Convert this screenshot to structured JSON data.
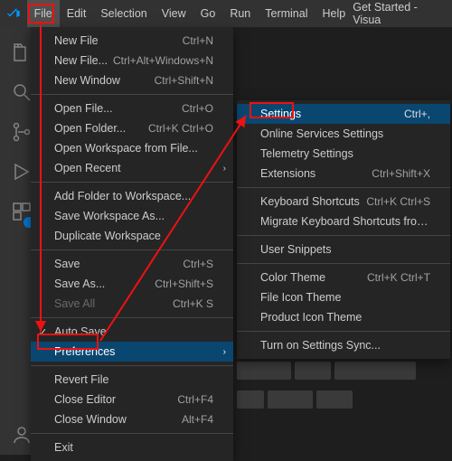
{
  "titlebar": {
    "title": "Get Started - Visua",
    "menus": [
      "File",
      "Edit",
      "Selection",
      "View",
      "Go",
      "Run",
      "Terminal",
      "Help"
    ]
  },
  "activitybar": {
    "icons": [
      "files-icon",
      "search-icon",
      "source-control-icon",
      "debug-icon",
      "extensions-icon",
      "account-icon"
    ]
  },
  "file_menu": {
    "groups": [
      [
        {
          "label": "New File",
          "accel": "Ctrl+N"
        },
        {
          "label": "New File...",
          "accel": "Ctrl+Alt+Windows+N"
        },
        {
          "label": "New Window",
          "accel": "Ctrl+Shift+N"
        }
      ],
      [
        {
          "label": "Open File...",
          "accel": "Ctrl+O"
        },
        {
          "label": "Open Folder...",
          "accel": "Ctrl+K Ctrl+O"
        },
        {
          "label": "Open Workspace from File..."
        },
        {
          "label": "Open Recent",
          "submenu": true
        }
      ],
      [
        {
          "label": "Add Folder to Workspace..."
        },
        {
          "label": "Save Workspace As..."
        },
        {
          "label": "Duplicate Workspace"
        }
      ],
      [
        {
          "label": "Save",
          "accel": "Ctrl+S"
        },
        {
          "label": "Save As...",
          "accel": "Ctrl+Shift+S"
        },
        {
          "label": "Save All",
          "accel": "Ctrl+K S",
          "disabled": true
        }
      ],
      [
        {
          "label": "Auto Save",
          "checked": true
        },
        {
          "label": "Preferences",
          "submenu": true,
          "highlight": true
        }
      ],
      [
        {
          "label": "Revert File"
        },
        {
          "label": "Close Editor",
          "accel": "Ctrl+F4"
        },
        {
          "label": "Close Window",
          "accel": "Alt+F4"
        }
      ],
      [
        {
          "label": "Exit"
        }
      ]
    ]
  },
  "preferences_submenu": {
    "groups": [
      [
        {
          "label": "Settings",
          "accel": "Ctrl+,",
          "highlight": true
        },
        {
          "label": "Online Services Settings"
        },
        {
          "label": "Telemetry Settings"
        },
        {
          "label": "Extensions",
          "accel": "Ctrl+Shift+X"
        }
      ],
      [
        {
          "label": "Keyboard Shortcuts",
          "accel": "Ctrl+K Ctrl+S"
        },
        {
          "label": "Migrate Keyboard Shortcuts from..."
        }
      ],
      [
        {
          "label": "User Snippets"
        }
      ],
      [
        {
          "label": "Color Theme",
          "accel": "Ctrl+K Ctrl+T"
        },
        {
          "label": "File Icon Theme"
        },
        {
          "label": "Product Icon Theme"
        }
      ],
      [
        {
          "label": "Turn on Settings Sync..."
        }
      ]
    ]
  },
  "annotations": {
    "file_box": "file-menu-highlight",
    "preferences_box": "preferences-highlight",
    "settings_box": "settings-highlight"
  }
}
